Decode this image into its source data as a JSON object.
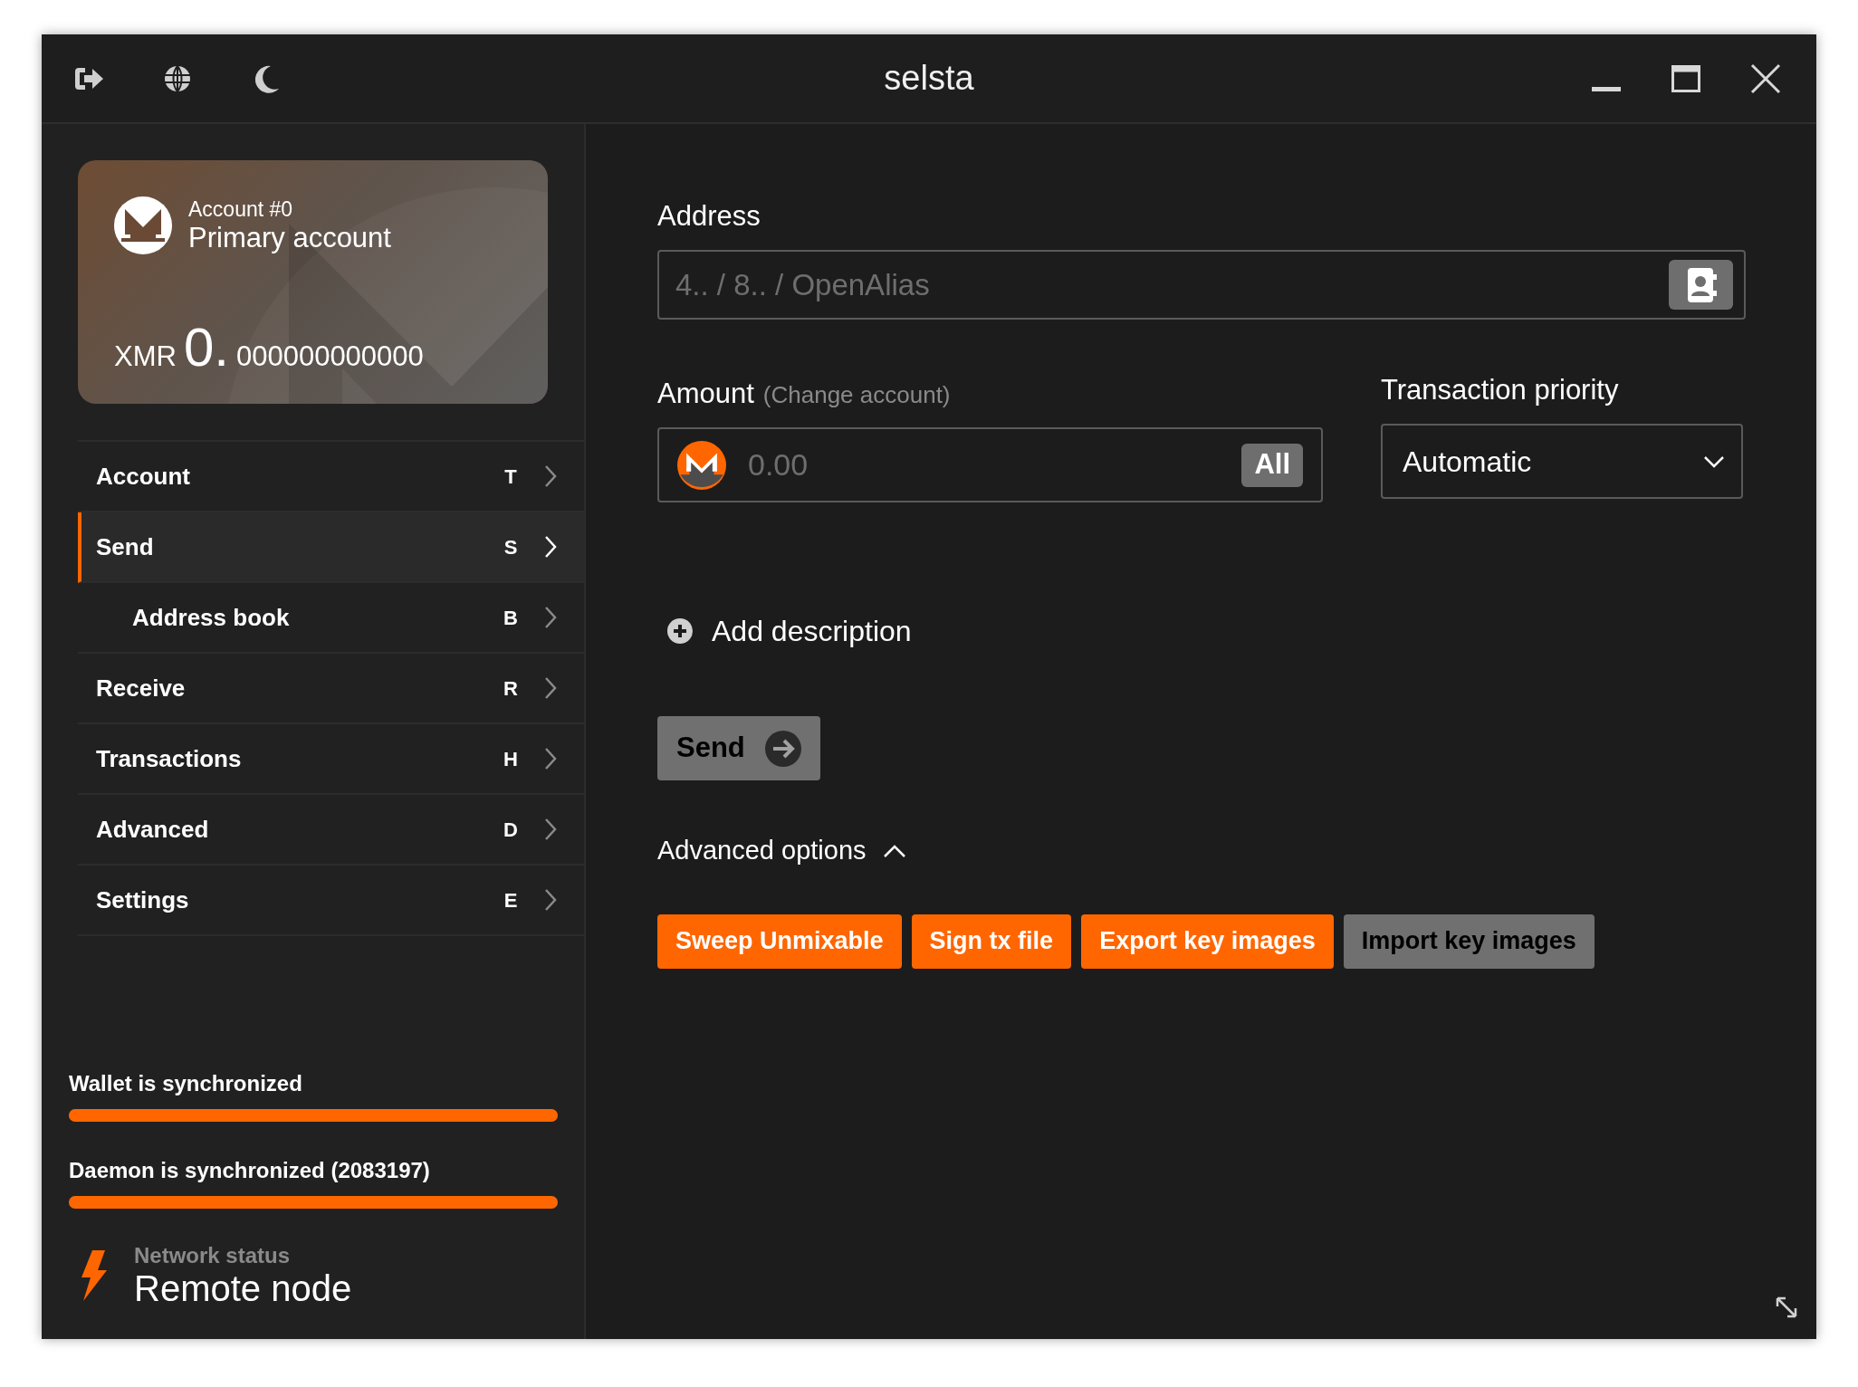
{
  "window": {
    "title": "selsta"
  },
  "account_card": {
    "account_number": "Account #0",
    "account_name": "Primary account",
    "currency": "XMR",
    "balance_integer": "0.",
    "balance_decimals": "000000000000"
  },
  "sidebar": {
    "items": [
      {
        "label": "Account",
        "shortcut": "T",
        "selected": false
      },
      {
        "label": "Send",
        "shortcut": "S",
        "selected": true,
        "children": [
          {
            "label": "Address book",
            "shortcut": "B",
            "selected": false
          }
        ]
      },
      {
        "label": "Receive",
        "shortcut": "R",
        "selected": false
      },
      {
        "label": "Transactions",
        "shortcut": "H",
        "selected": false
      },
      {
        "label": "Advanced",
        "shortcut": "D",
        "selected": false
      },
      {
        "label": "Settings",
        "shortcut": "E",
        "selected": false
      }
    ]
  },
  "sync": [
    {
      "label": "Wallet is synchronized",
      "level": 1
    },
    {
      "label": "Daemon is synchronized (2083197)",
      "level": 1
    }
  ],
  "network": {
    "label": "Network status",
    "value": "Remote node"
  },
  "form": {
    "address_label": "Address",
    "address_placeholder": "4.. / 8.. / OpenAlias",
    "amount_label": "Amount",
    "amount_link": "(Change account)",
    "amount_placeholder": "0.00",
    "all_button": "All",
    "priority_label": "Transaction priority",
    "priority_value": "Automatic",
    "add_description": "Add description",
    "send_button": "Send",
    "advanced_options": "Advanced options",
    "advanced_expanded": true
  },
  "advanced_buttons": [
    {
      "label": "Sweep Unmixable",
      "disabled": false
    },
    {
      "label": "Sign tx file",
      "disabled": false
    },
    {
      "label": "Export key images",
      "disabled": false
    },
    {
      "label": "Import key images",
      "disabled": true
    }
  ]
}
